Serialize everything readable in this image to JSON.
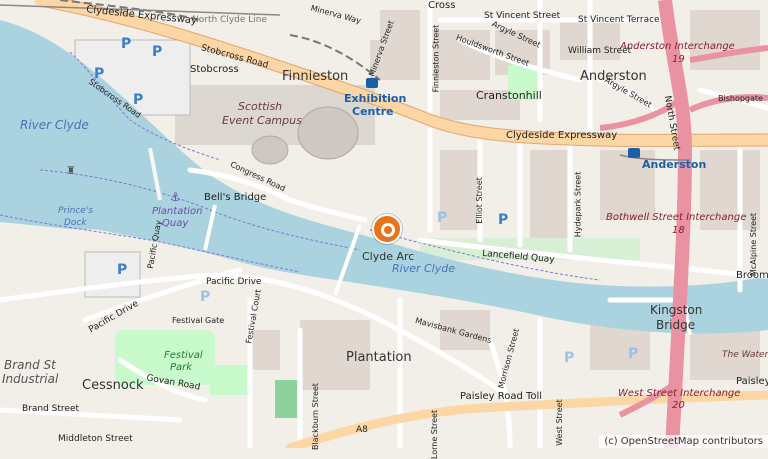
{
  "labels": {
    "places": [
      "Finnieston",
      "Anderston",
      "Cranstonhill",
      "Plantation",
      "Cessnock",
      "Kingston",
      "Bridge",
      "Brand St",
      "Industrial",
      "Stobcross",
      "Cross"
    ],
    "water": [
      "River Clyde",
      "River Clyde"
    ],
    "pois": [
      "Scottish",
      "Event Campus",
      "Prince's",
      "Dock",
      "Plantation",
      "Quay",
      "Festival",
      "Park",
      "The Water"
    ],
    "stations": [
      "Exhibition",
      "Centre",
      "Anderston"
    ],
    "interchanges": [
      "Anderston Interchange",
      "19",
      "Bothwell Street Interchange",
      "18",
      "West Street Interchange",
      "20"
    ],
    "bridges": [
      "Bell's Bridge",
      "Clyde Arc"
    ],
    "streets": [
      "Clydeside Expressway",
      "Clydeside Expressway",
      "North Clyde Line",
      "Stobcross Road",
      "Stobcross Road",
      "Minerva Way",
      "Minerva Street",
      "Finnieston Street",
      "St Vincent Street",
      "St Vincent Terrace",
      "Argyle Street",
      "Houldsworth Street",
      "William Street",
      "Argyle Street",
      "Bishopgate",
      "North Street",
      "Congress Road",
      "Elliot Street",
      "Hydepark Street",
      "McAlpine Street",
      "Lancefield Quay",
      "Pacific Quay",
      "Pacific Drive",
      "Pacific Drive",
      "Festival Court",
      "Festival Gate",
      "Mavisbank Gardens",
      "Blackburn Street",
      "Paisley Road Toll",
      "Paisley",
      "Govan Road",
      "Brand Street",
      "Middleton Street",
      "A8",
      "Broom",
      "Morrison Street",
      "West Street",
      "Lorne Street"
    ],
    "parking": [
      "P",
      "P",
      "P",
      "P",
      "P",
      "P",
      "P",
      "P",
      "P",
      "P"
    ]
  },
  "attribution": "(c) OpenStreetMap contributors",
  "colors": {
    "land": "#f2efe9",
    "water": "#aad3df",
    "motorway": "#e892a2",
    "trunk": "#fcd6a4",
    "rail": "#777777",
    "park": "#c8facc",
    "building": "#d9d0c9",
    "marker": "#e8731b"
  }
}
